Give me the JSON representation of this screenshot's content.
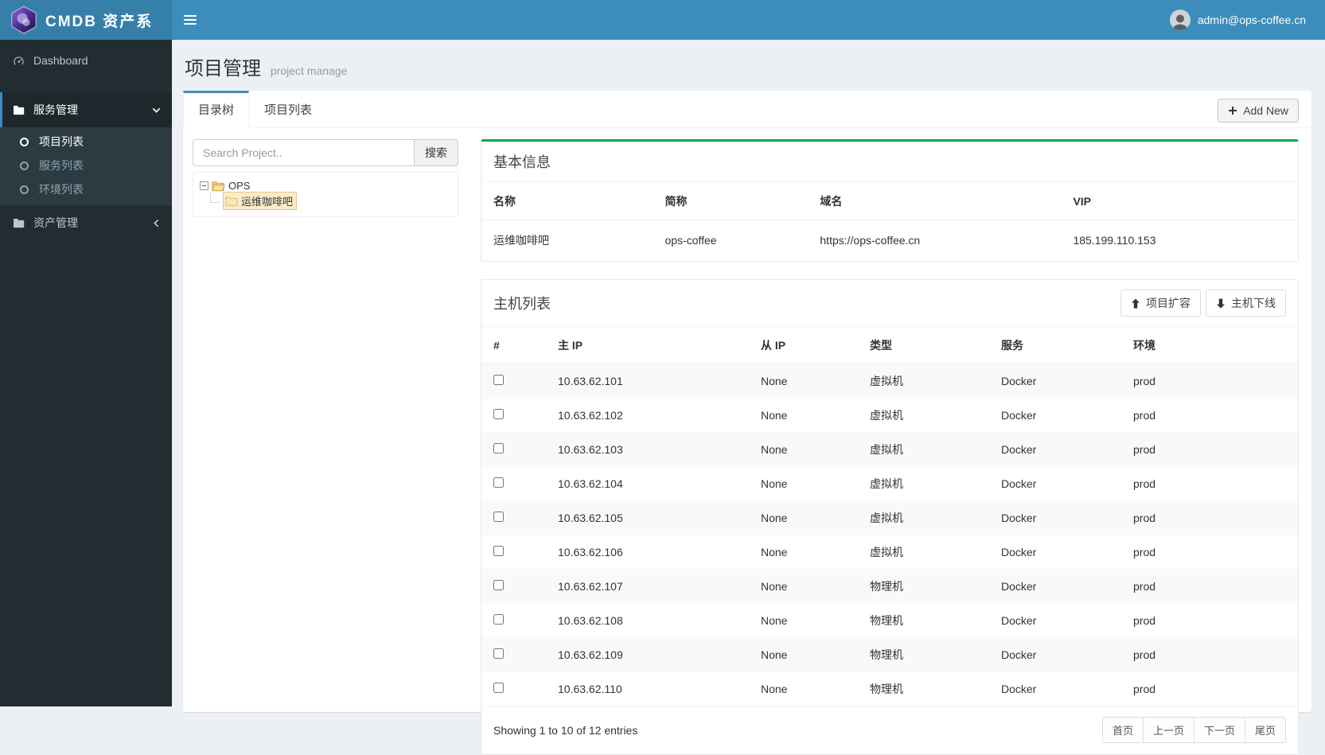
{
  "navbar": {
    "brand": "CMDB 资产系",
    "user_email": "admin@ops-coffee.cn"
  },
  "sidebar": {
    "items": [
      {
        "label": "Dashboard",
        "icon": "dashboard-icon"
      },
      {
        "label": "服务管理",
        "icon": "folder-icon",
        "chevron": "down",
        "active": true
      },
      {
        "label": "资产管理",
        "icon": "folder-icon",
        "chevron": "left"
      }
    ],
    "submenu": [
      {
        "label": "项目列表",
        "active": true
      },
      {
        "label": "服务列表",
        "active": false
      },
      {
        "label": "环境列表",
        "active": false
      }
    ]
  },
  "header": {
    "title": "项目管理",
    "subtitle": "project manage"
  },
  "tabs": [
    {
      "label": "目录树",
      "active": true
    },
    {
      "label": "项目列表",
      "active": false
    }
  ],
  "add_new_label": "Add New",
  "tree_panel": {
    "search_placeholder": "Search Project..",
    "search_button": "搜索",
    "root_node": "OPS",
    "child_node": "运维咖啡吧"
  },
  "basic_info": {
    "title": "基本信息",
    "columns": [
      "名称",
      "简称",
      "域名",
      "VIP"
    ],
    "row": [
      "运维咖啡吧",
      "ops-coffee",
      "https://ops-coffee.cn",
      "185.199.110.153"
    ]
  },
  "host_list": {
    "title": "主机列表",
    "expand_button": "项目扩容",
    "offline_button": "主机下线",
    "columns": [
      "#",
      "主 IP",
      "从 IP",
      "类型",
      "服务",
      "环境"
    ],
    "rows": [
      {
        "ip": "10.63.62.101",
        "slave": "None",
        "type": "虚拟机",
        "service": "Docker",
        "env": "prod"
      },
      {
        "ip": "10.63.62.102",
        "slave": "None",
        "type": "虚拟机",
        "service": "Docker",
        "env": "prod"
      },
      {
        "ip": "10.63.62.103",
        "slave": "None",
        "type": "虚拟机",
        "service": "Docker",
        "env": "prod"
      },
      {
        "ip": "10.63.62.104",
        "slave": "None",
        "type": "虚拟机",
        "service": "Docker",
        "env": "prod"
      },
      {
        "ip": "10.63.62.105",
        "slave": "None",
        "type": "虚拟机",
        "service": "Docker",
        "env": "prod"
      },
      {
        "ip": "10.63.62.106",
        "slave": "None",
        "type": "虚拟机",
        "service": "Docker",
        "env": "prod"
      },
      {
        "ip": "10.63.62.107",
        "slave": "None",
        "type": "物理机",
        "service": "Docker",
        "env": "prod"
      },
      {
        "ip": "10.63.62.108",
        "slave": "None",
        "type": "物理机",
        "service": "Docker",
        "env": "prod"
      },
      {
        "ip": "10.63.62.109",
        "slave": "None",
        "type": "物理机",
        "service": "Docker",
        "env": "prod"
      },
      {
        "ip": "10.63.62.110",
        "slave": "None",
        "type": "物理机",
        "service": "Docker",
        "env": "prod"
      }
    ],
    "footer": "Showing 1 to 10 of 12 entries",
    "pagination": [
      "首页",
      "上一页",
      "下一页",
      "尾页"
    ]
  },
  "colors": {
    "navbar": "#3c8dbc",
    "brand_bg": "#367fa9",
    "sidebar_bg": "#222d32",
    "submenu_bg": "#2c3b41",
    "active_border": "#3c8dbc",
    "success_border": "#00a65a",
    "tree_selected_bg": "#fceccd",
    "stripe": "#f9f9f9"
  },
  "icons": {
    "brand": "cmdb-logo-icon",
    "menu": "hamburger-icon",
    "dashboard": "gauge-icon",
    "service": "folder-icon",
    "asset": "folder-icon",
    "submenu_bullet": "circle-icon",
    "add": "plus-icon",
    "expand": "arrow-up-icon",
    "offline": "arrow-down-icon",
    "tree_root": "open-folder-icon",
    "tree_child": "folder-icon"
  }
}
